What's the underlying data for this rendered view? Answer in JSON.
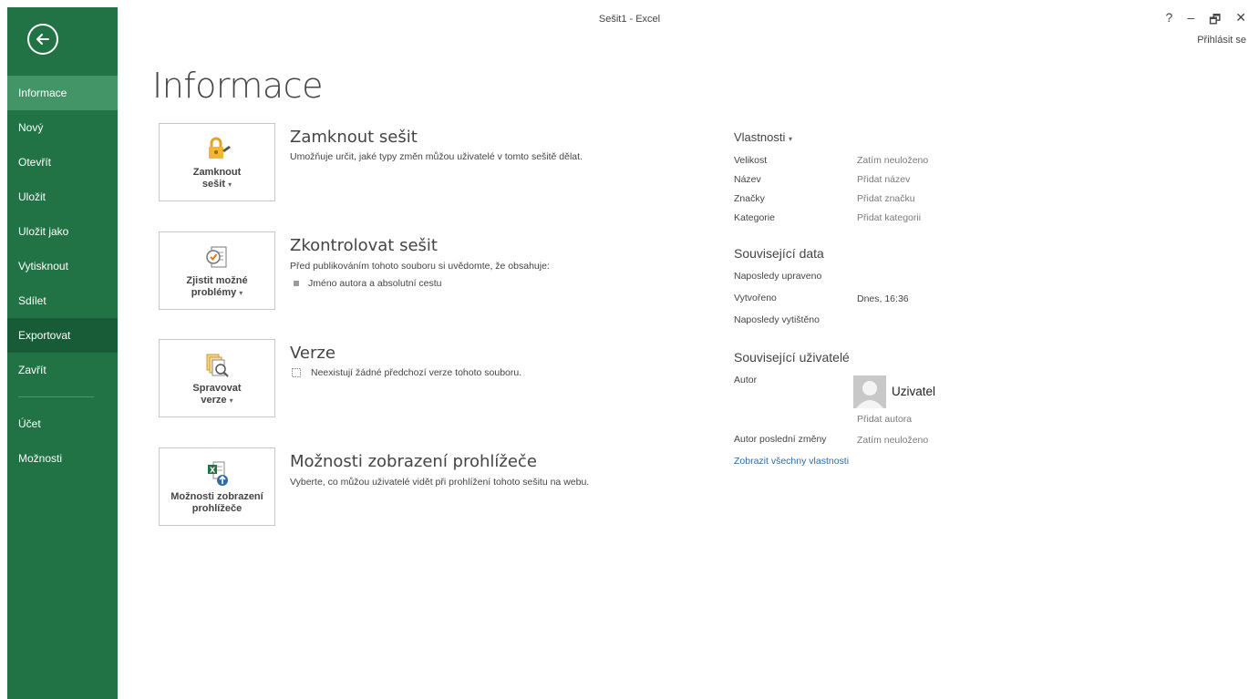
{
  "window": {
    "title": "Sešit1 - Excel",
    "help": "?",
    "minimize": "–",
    "restore": "🗗",
    "close": "✕",
    "signin": "Přihlásit se"
  },
  "nav": {
    "items": [
      {
        "label": "Informace"
      },
      {
        "label": "Nový"
      },
      {
        "label": "Otevřít"
      },
      {
        "label": "Uložit"
      },
      {
        "label": "Uložit jako"
      },
      {
        "label": "Vytisknout"
      },
      {
        "label": "Sdílet"
      },
      {
        "label": "Exportovat"
      },
      {
        "label": "Zavřít"
      },
      {
        "label": "Účet"
      },
      {
        "label": "Možnosti"
      }
    ],
    "selected": "Informace",
    "hovered": "Exportovat"
  },
  "page": {
    "title": "Informace"
  },
  "sections": {
    "protect": {
      "button_line1": "Zamknout",
      "button_line2": "sešit",
      "title": "Zamknout sešit",
      "desc": "Umožňuje určit, jaké typy změn můžou uživatelé v tomto sešitě dělat."
    },
    "inspect": {
      "button_line1": "Zjistit možné",
      "button_line2": "problémy",
      "title": "Zkontrolovat sešit",
      "desc": "Před publikováním tohoto souboru si uvědomte, že obsahuje:",
      "bullet": "Jméno autora a absolutní cestu"
    },
    "versions": {
      "button_line1": "Spravovat",
      "button_line2": "verze",
      "title": "Verze",
      "desc": "Neexistují žádné předchozí verze tohoto souboru."
    },
    "browser": {
      "button_line1": "Možnosti zobrazení",
      "button_line2": "prohlížeče",
      "title": "Možnosti zobrazení prohlížeče",
      "desc": "Vyberte, co můžou uživatelé vidět při prohlížení tohoto sešitu na webu."
    }
  },
  "properties": {
    "heading": "Vlastnosti",
    "rows": [
      {
        "label": "Velikost",
        "value": "Zatím neuloženo"
      },
      {
        "label": "Název",
        "value": "Přidat název"
      },
      {
        "label": "Značky",
        "value": "Přidat značku"
      },
      {
        "label": "Kategorie",
        "value": "Přidat kategorii"
      }
    ],
    "related_dates": {
      "heading": "Související data",
      "last_modified": "Naposledy upraveno",
      "created": "Vytvořeno",
      "created_value": "Dnes, 16:36",
      "last_printed": "Naposledy vytištěno"
    },
    "related_people": {
      "heading": "Související uživatelé",
      "author_label": "Autor",
      "author_name": "Uzivatel",
      "add_author": "Přidat autora",
      "last_modified_by": "Autor poslední změny",
      "last_modified_by_value": "Zatím neuloženo"
    },
    "show_all": "Zobrazit všechny vlastnosti"
  },
  "colors": {
    "accent": "#217346",
    "nav_selected": "#439467",
    "nav_hover": "#185c37",
    "link": "#2e6aa3"
  }
}
